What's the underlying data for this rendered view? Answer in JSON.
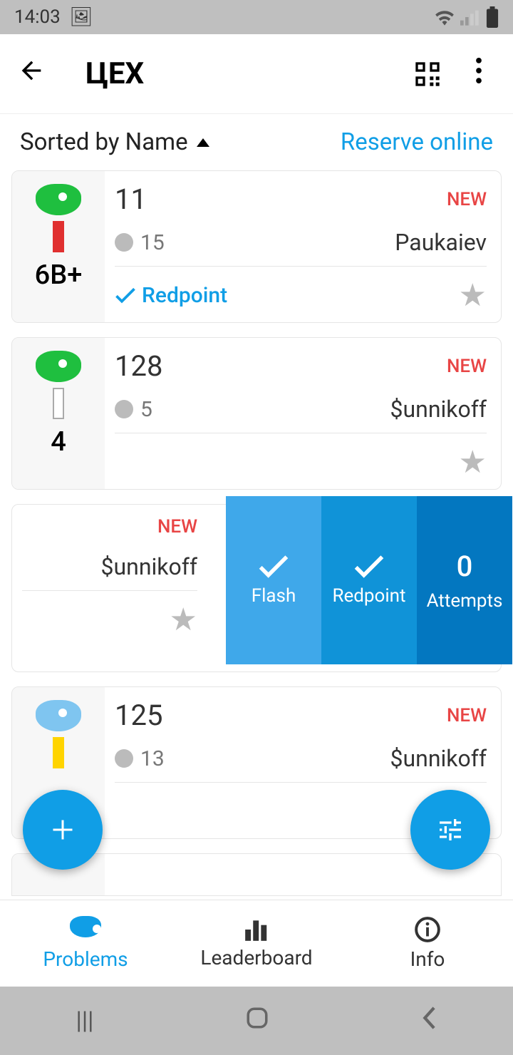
{
  "status": {
    "time": "14:03"
  },
  "header": {
    "title": "ЦЕХ"
  },
  "sort": {
    "label": "Sorted by Name",
    "reserve": "Reserve online"
  },
  "problems": [
    {
      "name": "11",
      "new": "NEW",
      "ascents": "15",
      "setter": "Paukaiev",
      "grade": "6B+",
      "tick": "Redpoint"
    },
    {
      "name": "128",
      "new": "NEW",
      "ascents": "5",
      "setter": "$unnikoff",
      "grade": "4",
      "tick": ""
    },
    {
      "name": "",
      "new": "NEW",
      "ascents": "",
      "setter": "$unnikoff",
      "grade": "",
      "tick": ""
    },
    {
      "name": "125",
      "new": "NEW",
      "ascents": "13",
      "setter": "$unnikoff",
      "grade": "",
      "tick": ""
    }
  ],
  "swipe": {
    "flash": "Flash",
    "redpoint": "Redpoint",
    "attempts_count": "0",
    "attempts": "Attempts"
  },
  "nav": {
    "problems": "Problems",
    "leaderboard": "Leaderboard",
    "info": "Info"
  }
}
